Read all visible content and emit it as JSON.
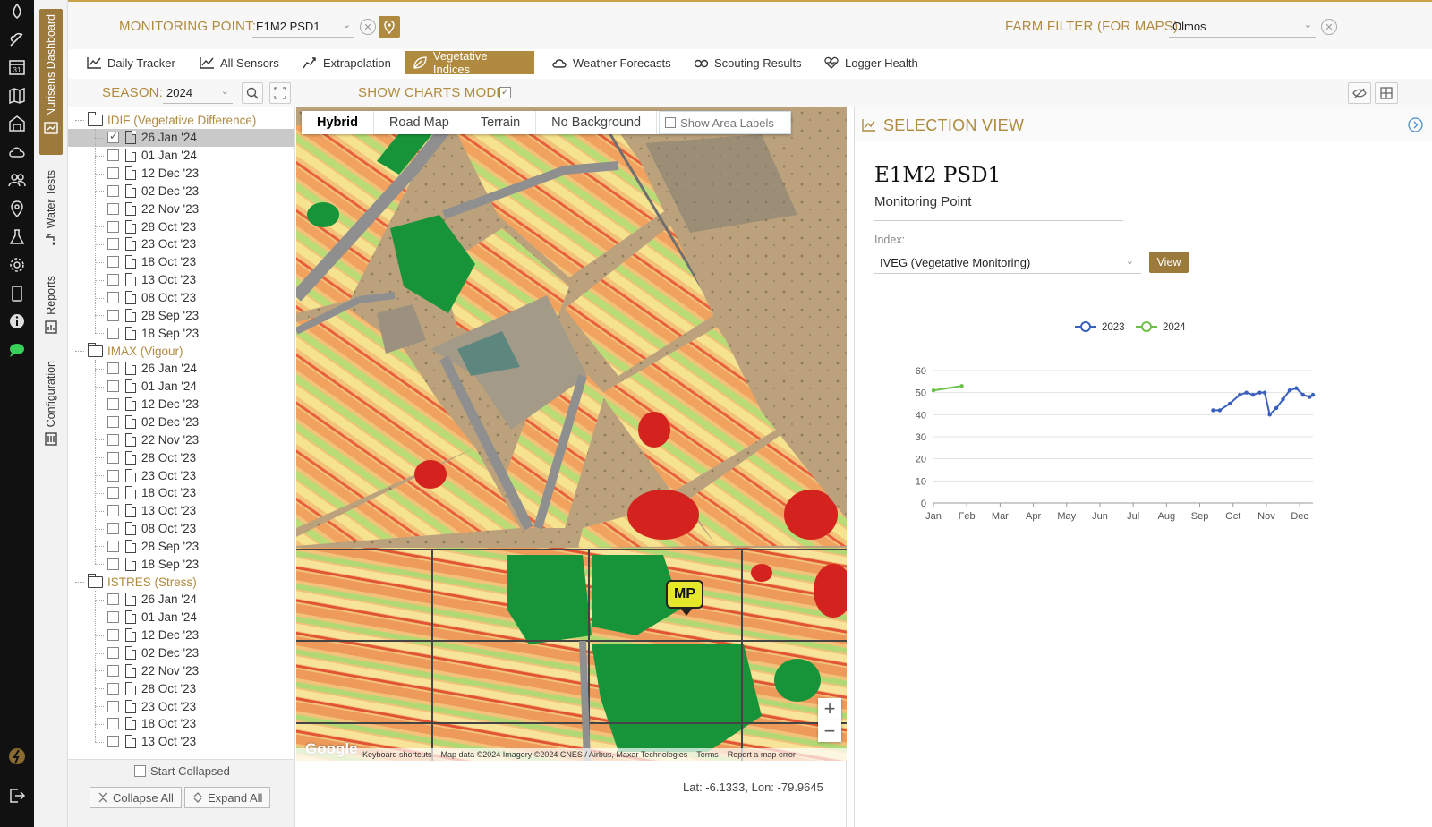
{
  "left_rail": {
    "icons": [
      "leaf-drop-icon",
      "sprout-icon",
      "calendar-icon",
      "map-book-icon",
      "warehouse-icon",
      "cloud-icon",
      "users-icon",
      "location-icon",
      "flask-icon",
      "gear-icon",
      "tablet-icon",
      "info-icon",
      "chat-icon",
      "brand-logo-icon",
      "logout-icon"
    ],
    "calendar_day": "31"
  },
  "vertical_tabs": [
    {
      "label": "Nurisens Dashboard",
      "active": true
    },
    {
      "label": "Water Tests",
      "active": false
    },
    {
      "label": "Reports",
      "active": false
    },
    {
      "label": "Configuration",
      "active": false
    }
  ],
  "header": {
    "monitoring_point_label": "MONITORING POINT:",
    "monitoring_point_value": "E1M2 PSD1",
    "farm_filter_label": "FARM FILTER (FOR MAPS):",
    "farm_filter_value": "Olmos",
    "accent": "#b08a3e"
  },
  "tabs": [
    {
      "label": "Daily Tracker",
      "icon": "line-chart-icon",
      "active": false
    },
    {
      "label": "All Sensors",
      "icon": "line-chart-icon",
      "active": false
    },
    {
      "label": "Extrapolation",
      "icon": "extrapolation-icon",
      "active": false
    },
    {
      "label": "Vegetative Indices",
      "icon": "leaf-icon",
      "active": true
    },
    {
      "label": "Weather Forecasts",
      "icon": "cloud-icon",
      "active": false
    },
    {
      "label": "Scouting Results",
      "icon": "scout-icon",
      "active": false
    },
    {
      "label": "Logger Health",
      "icon": "heart-icon",
      "active": false
    }
  ],
  "season": {
    "label": "SEASON:",
    "value": "2024",
    "show_charts_label": "SHOW CHARTS MODE:",
    "show_charts_checked": true
  },
  "tree": {
    "groups": [
      {
        "label": "IDIF (Vegetative Difference)",
        "items": [
          "26 Jan '24",
          "01 Jan '24",
          "12 Dec '23",
          "02 Dec '23",
          "22 Nov '23",
          "28 Oct '23",
          "23 Oct '23",
          "18 Oct '23",
          "13 Oct '23",
          "08 Oct '23",
          "28 Sep '23",
          "18 Sep '23"
        ],
        "selected_index": 0
      },
      {
        "label": "IMAX (Vigour)",
        "items": [
          "26 Jan '24",
          "01 Jan '24",
          "12 Dec '23",
          "02 Dec '23",
          "22 Nov '23",
          "28 Oct '23",
          "23 Oct '23",
          "18 Oct '23",
          "13 Oct '23",
          "08 Oct '23",
          "28 Sep '23",
          "18 Sep '23"
        ]
      },
      {
        "label": "ISTRES (Stress)",
        "items": [
          "26 Jan '24",
          "01 Jan '24",
          "12 Dec '23",
          "02 Dec '23",
          "22 Nov '23",
          "28 Oct '23",
          "23 Oct '23",
          "18 Oct '23",
          "13 Oct '23"
        ]
      }
    ],
    "start_collapsed_label": "Start Collapsed",
    "collapse_all_label": "Collapse All",
    "expand_all_label": "Expand All"
  },
  "map": {
    "types": [
      "Hybrid",
      "Road Map",
      "Terrain",
      "No Background"
    ],
    "active_type": "Hybrid",
    "show_area_labels": "Show Area Labels",
    "marker_label": "MP",
    "google": "Google",
    "attribution": [
      "Keyboard shortcuts",
      "Map data ©2024 Imagery ©2024 CNES / Airbus, Maxar Technologies",
      "Terms",
      "Report a map error"
    ],
    "latlon": "Lat: -6.1333, Lon: -79.9645"
  },
  "selection_view": {
    "title": "SELECTION VIEW",
    "point_name": "E1M2 PSD1",
    "point_type": "Monitoring Point",
    "index_label": "Index:",
    "index_value": "IVEG (Vegetative Monitoring)",
    "view_button": "View"
  },
  "chart_data": {
    "type": "line",
    "title": "",
    "xlabel": "",
    "ylabel": "",
    "x_ticks": [
      "Jan",
      "Feb",
      "Mar",
      "Apr",
      "May",
      "Jun",
      "Jul",
      "Aug",
      "Sep",
      "Oct",
      "Nov",
      "Dec"
    ],
    "xlim": [
      0,
      11.4
    ],
    "ylim": [
      0,
      60
    ],
    "y_ticks": [
      0,
      10,
      20,
      30,
      40,
      50,
      60
    ],
    "grid": true,
    "legend": "top-center",
    "series": [
      {
        "name": "2023",
        "color": "#3a5fbf",
        "x": [
          8.4,
          8.6,
          8.9,
          9.2,
          9.4,
          9.6,
          9.8,
          9.95,
          10.1,
          10.3,
          10.5,
          10.7,
          10.9,
          11.1,
          11.3,
          11.4
        ],
        "y": [
          42,
          42,
          45,
          49,
          50,
          49,
          50,
          50,
          40,
          43,
          47,
          51,
          52,
          49,
          48,
          49
        ]
      },
      {
        "name": "2024",
        "color": "#6cc04a",
        "x": [
          0,
          0.85
        ],
        "y": [
          51,
          53
        ]
      }
    ]
  }
}
